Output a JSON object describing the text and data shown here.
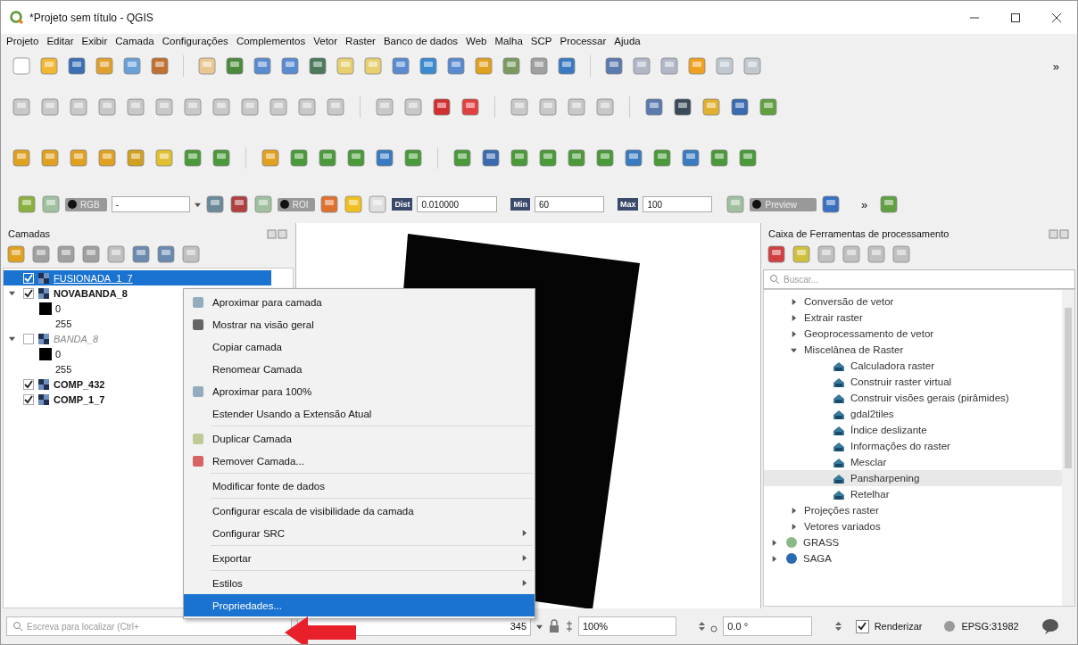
{
  "window": {
    "title": "*Projeto sem título - QGIS"
  },
  "menu_bar": [
    "Projeto",
    "Editar",
    "Exibir",
    "Camada",
    "Configurações",
    "Complementos",
    "Vetor",
    "Raster",
    "Banco de dados",
    "Web",
    "Malha",
    "SCP",
    "Processar",
    "Ajuda"
  ],
  "toolbar_overflow": "»",
  "plugin_toolbar": {
    "band_toggle": "RGB",
    "band_select": "-",
    "roi_toggle": "ROI",
    "dist_label": "Dist",
    "dist_value": "0.010000",
    "min_label": "Min",
    "min_value": "60",
    "max_label": "Max",
    "max_value": "100",
    "preview_toggle": "Preview",
    "overflow": "»"
  },
  "layers_panel": {
    "title": "Camadas",
    "layers": [
      {
        "name": "FUSIONADA_1_7",
        "checked": true,
        "selected": true
      },
      {
        "name": "NOVABANDA_8",
        "checked": true,
        "selected": false,
        "expanded": true,
        "legend": [
          {
            "label": "0",
            "swatch": true
          },
          {
            "label": "255",
            "swatch": false
          }
        ]
      },
      {
        "name": "BANDA_8",
        "checked": false,
        "selected": false,
        "expanded": true,
        "legend": [
          {
            "label": "0",
            "swatch": true
          },
          {
            "label": "255",
            "swatch": false
          }
        ]
      },
      {
        "name": "COMP_432",
        "checked": true,
        "selected": false
      },
      {
        "name": "COMP_1_7",
        "checked": true,
        "selected": false
      }
    ]
  },
  "context_menu": [
    {
      "kind": "item",
      "label": "Aproximar para camada",
      "submenu": false,
      "selected": false
    },
    {
      "kind": "item",
      "label": "Mostrar na visão geral",
      "submenu": false,
      "selected": false
    },
    {
      "kind": "item",
      "label": "Copiar camada",
      "submenu": false,
      "selected": false
    },
    {
      "kind": "item",
      "label": "Renomear Camada",
      "submenu": false,
      "selected": false
    },
    {
      "kind": "item",
      "label": "Aproximar para 100%",
      "submenu": false,
      "selected": false
    },
    {
      "kind": "item",
      "label": "Estender Usando a Extensão Atual",
      "submenu": false,
      "selected": false
    },
    {
      "kind": "separator"
    },
    {
      "kind": "item",
      "label": "Duplicar Camada",
      "submenu": false,
      "selected": false
    },
    {
      "kind": "item",
      "label": "Remover Camada...",
      "submenu": false,
      "selected": false
    },
    {
      "kind": "separator"
    },
    {
      "kind": "item",
      "label": "Modificar fonte de dados",
      "submenu": false,
      "selected": false
    },
    {
      "kind": "separator"
    },
    {
      "kind": "item",
      "label": "Configurar escala de visibilidade da camada",
      "submenu": false,
      "selected": false
    },
    {
      "kind": "item",
      "label": "Configurar SRC",
      "submenu": true,
      "selected": false
    },
    {
      "kind": "separator"
    },
    {
      "kind": "item",
      "label": "Exportar",
      "submenu": true,
      "selected": false
    },
    {
      "kind": "separator"
    },
    {
      "kind": "item",
      "label": "Estilos",
      "submenu": true,
      "selected": false
    },
    {
      "kind": "item",
      "label": "Propriedades...",
      "submenu": false,
      "selected": true
    }
  ],
  "processing_panel": {
    "title": "Caixa de Ferramentas de processamento",
    "search_placeholder": "Buscar...",
    "groups": [
      {
        "label": "Conversão de vetor",
        "expanded": false
      },
      {
        "label": "Extrair raster",
        "expanded": false
      },
      {
        "label": "Geoprocessamento de vetor",
        "expanded": false
      },
      {
        "label": "Miscelânea de Raster",
        "expanded": true,
        "children": [
          {
            "label": "Calculadora raster",
            "selected": false
          },
          {
            "label": "Construir raster virtual",
            "selected": false
          },
          {
            "label": "Construir visões gerais (pirâmides)",
            "selected": false
          },
          {
            "label": "gdal2tiles",
            "selected": false
          },
          {
            "label": "Índice deslizante",
            "selected": false
          },
          {
            "label": "Informações do raster",
            "selected": false
          },
          {
            "label": "Mesclar",
            "selected": false
          },
          {
            "label": "Pansharpening",
            "selected": true
          },
          {
            "label": "Retelhar",
            "selected": false
          }
        ]
      },
      {
        "label": "Projeções raster",
        "expanded": false
      },
      {
        "label": "Vetores variados",
        "expanded": false
      }
    ],
    "providers": [
      {
        "label": "GRASS",
        "expanded": false
      },
      {
        "label": "SAGA",
        "expanded": false
      }
    ]
  },
  "status_bar": {
    "locator_placeholder": "Escreva para localizar (Ctrl+",
    "scale": "345",
    "magnifier": "100%",
    "rotation": "0.0 °",
    "render_label": "Renderizar",
    "render_checked": true,
    "crs": "EPSG:31982"
  }
}
